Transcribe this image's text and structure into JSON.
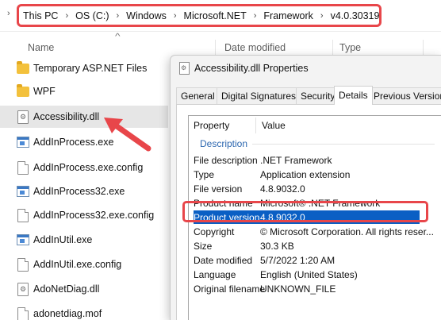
{
  "address_bar": {
    "crumbs": [
      "This PC",
      "OS (C:)",
      "Windows",
      "Microsoft.NET",
      "Framework",
      "v4.0.30319"
    ]
  },
  "file_list": {
    "columns": [
      "Name",
      "Date modified",
      "Type"
    ],
    "items": [
      {
        "name": "Temporary ASP.NET Files",
        "icon": "folder-icon"
      },
      {
        "name": "WPF",
        "icon": "folder-icon"
      },
      {
        "name": "Accessibility.dll",
        "icon": "dll-file-icon",
        "selected": true
      },
      {
        "name": "AddInProcess.exe",
        "icon": "exe-file-icon"
      },
      {
        "name": "AddInProcess.exe.config",
        "icon": "config-file-icon"
      },
      {
        "name": "AddInProcess32.exe",
        "icon": "exe-file-icon"
      },
      {
        "name": "AddInProcess32.exe.config",
        "icon": "config-file-icon"
      },
      {
        "name": "AddInUtil.exe",
        "icon": "exe-file-icon"
      },
      {
        "name": "AddInUtil.exe.config",
        "icon": "config-file-icon"
      },
      {
        "name": "AdoNetDiag.dll",
        "icon": "dll-file-icon"
      },
      {
        "name": "adonetdiag.mof",
        "icon": "file-icon"
      }
    ]
  },
  "dialog": {
    "title": "Accessibility.dll Properties",
    "tabs": [
      "General",
      "Digital Signatures",
      "Security",
      "Details",
      "Previous Versions"
    ],
    "active_tab": "Details",
    "table": {
      "headers": [
        "Property",
        "Value"
      ],
      "section": "Description",
      "rows": [
        {
          "key": "File description",
          "value": ".NET Framework"
        },
        {
          "key": "Type",
          "value": "Application extension"
        },
        {
          "key": "File version",
          "value": "4.8.9032.0"
        },
        {
          "key": "Product name",
          "value": "Microsoft® .NET Framework"
        },
        {
          "key": "Product version",
          "value": "4.8.9032.0",
          "selected": true
        },
        {
          "key": "Copyright",
          "value": "© Microsoft Corporation.  All rights reser..."
        },
        {
          "key": "Size",
          "value": "30.3 KB"
        },
        {
          "key": "Date modified",
          "value": "5/7/2022 1:20 AM"
        },
        {
          "key": "Language",
          "value": "English (United States)"
        },
        {
          "key": "Original filename",
          "value": "UNKNOWN_FILE"
        }
      ]
    }
  },
  "colors": {
    "annotation_red": "#e8464a",
    "selection_blue": "#0a5fc4",
    "section_blue": "#2e68b0"
  }
}
